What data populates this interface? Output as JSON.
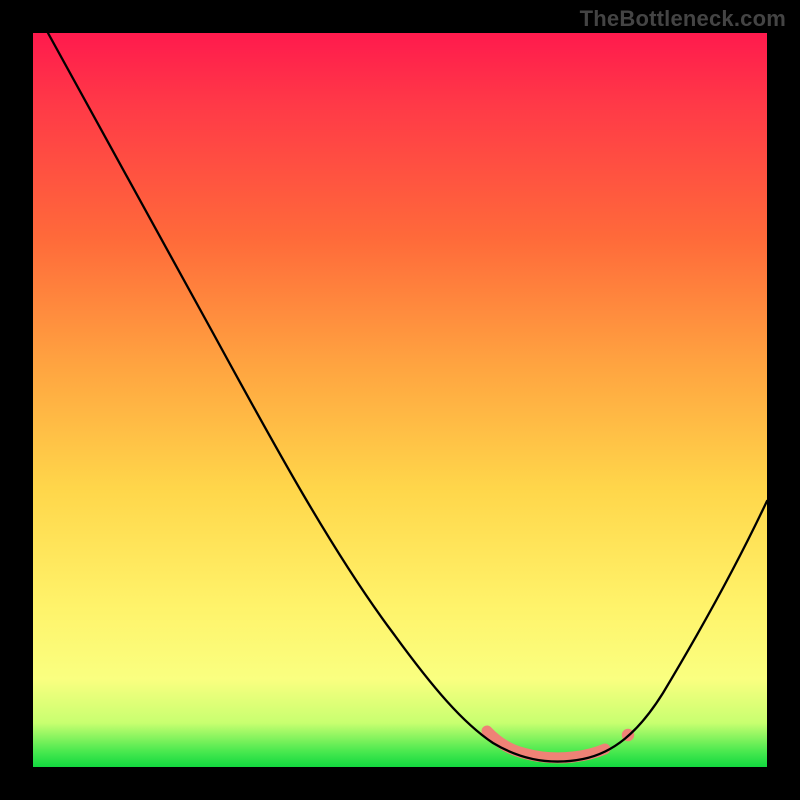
{
  "watermark": "TheBottleneck.com",
  "chart_data": {
    "type": "line",
    "title": "",
    "xlabel": "",
    "ylabel": "",
    "ylim": [
      0,
      100
    ],
    "xlim": [
      0,
      100
    ],
    "x": [
      0,
      5,
      10,
      15,
      20,
      25,
      30,
      35,
      40,
      45,
      50,
      55,
      60,
      62,
      65,
      68,
      70,
      72,
      75,
      78,
      80,
      85,
      90,
      95,
      100
    ],
    "values": [
      100,
      94,
      87,
      79,
      71,
      62,
      54,
      45,
      37,
      29,
      21,
      14,
      7,
      5,
      3,
      2,
      1,
      1,
      2,
      3,
      5,
      10,
      18,
      27,
      37
    ],
    "highlight_region_x": [
      62,
      78
    ],
    "highlight_dot_x": 80,
    "gradient_colors": {
      "top": "#ff1a4d",
      "mid": "#ffd64a",
      "bottom": "#12d83f"
    }
  }
}
